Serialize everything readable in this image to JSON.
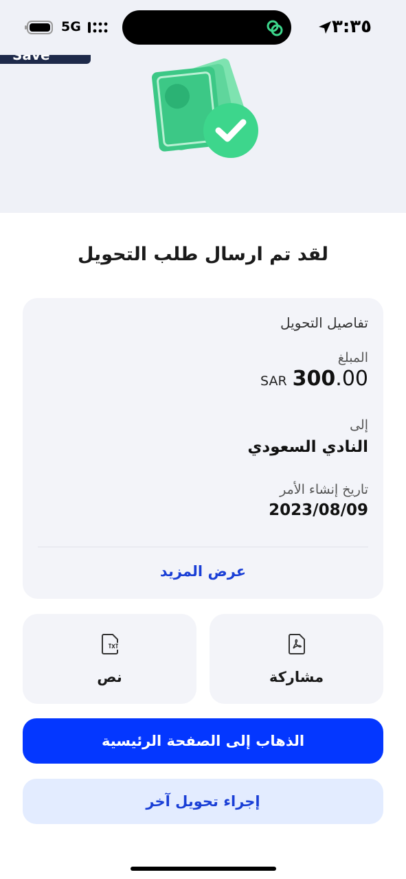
{
  "status_bar": {
    "time": "٣:٣٥",
    "network": "5G",
    "icons": [
      "location-arrow-icon",
      "signal-icon",
      "battery-icon",
      "link-icon"
    ]
  },
  "banner": {
    "text": "Save"
  },
  "hero_icon": "money-check-icon",
  "title": "لقد تم ارسال طلب التحويل",
  "details": {
    "heading": "تفاصيل التحويل",
    "amount_label": "المبلغ",
    "amount_currency": "SAR",
    "amount_integer": "300",
    "amount_decimal": ".00",
    "to_label": "إلى",
    "to_value": "النادي السعودي",
    "date_label": "تاريخ إنشاء الأمر",
    "date_value": "2023/08/09",
    "more_link": "عرض المزيد"
  },
  "actions": {
    "share_label": "مشاركة",
    "share_icon": "pdf-file-icon",
    "text_label": "نص",
    "text_icon": "txt-file-icon"
  },
  "buttons": {
    "home": "الذهاب إلى الصفحة الرئيسية",
    "another": "إجراء تحويل آخر"
  },
  "colors": {
    "primary": "#0437ff",
    "secondary_bg": "#e3ecff",
    "link": "#1a3fd6",
    "success": "#3dd68c"
  }
}
